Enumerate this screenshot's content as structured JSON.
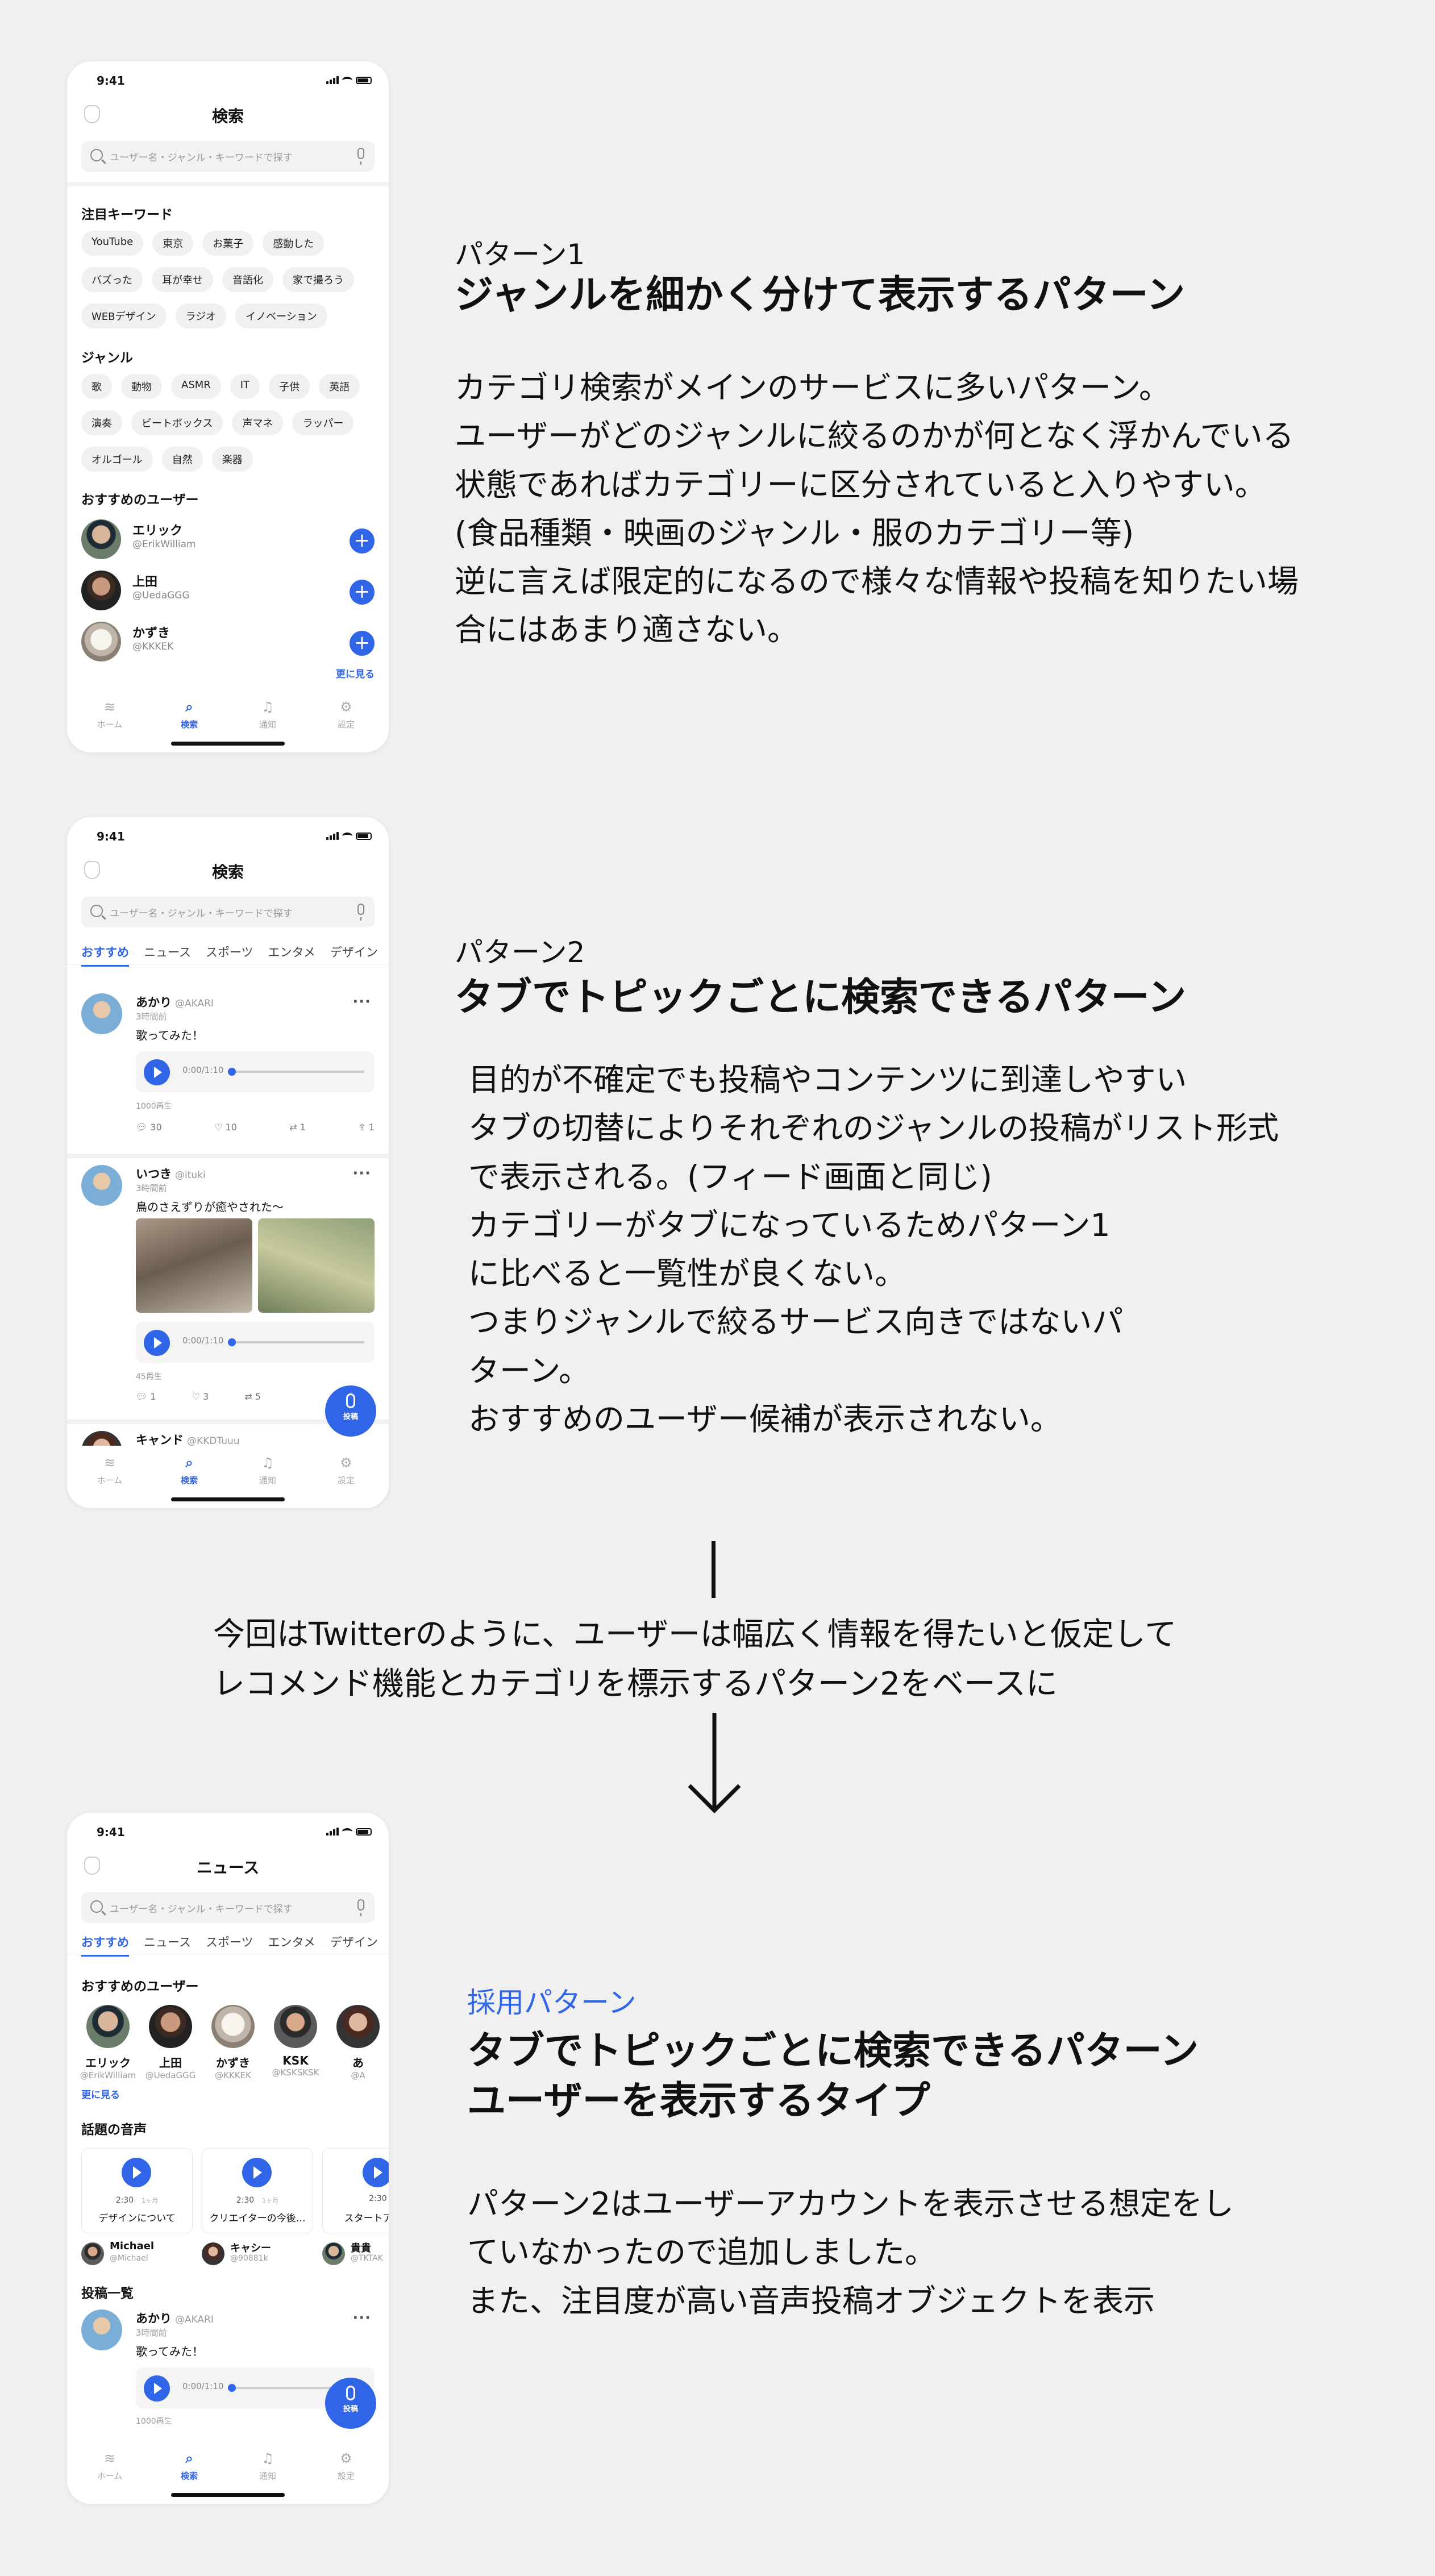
{
  "status_time": "9:41",
  "search_placeholder": "ユーザー名・ジャンル・キーワードで探す",
  "phone1": {
    "title": "検索",
    "keywords_heading": "注目キーワード",
    "keywords": [
      "YouTube",
      "東京",
      "お菓子",
      "感動した",
      "バズった",
      "耳が幸せ",
      "音語化",
      "家で撮ろう",
      "WEBデザイン",
      "ラジオ",
      "イノベーション"
    ],
    "genre_heading": "ジャンル",
    "genres": [
      "歌",
      "動物",
      "ASMR",
      "IT",
      "子供",
      "英語",
      "演奏",
      "ビートボックス",
      "声マネ",
      "ラッパー",
      "オルゴール",
      "自然",
      "楽器"
    ],
    "users_heading": "おすすめのユーザー",
    "users": [
      {
        "name": "エリック",
        "handle": "@ErikWilliam"
      },
      {
        "name": "上田",
        "handle": "@UedaGGG"
      },
      {
        "name": "かずき",
        "handle": "@KKKEK"
      }
    ],
    "more_label": "更に見る"
  },
  "tabbar": {
    "home": "ホーム",
    "search": "検索",
    "notify": "通知",
    "settings": "設定"
  },
  "tabs": [
    "おすすめ",
    "ニュース",
    "スポーツ",
    "エンタメ",
    "デザイン"
  ],
  "phone2": {
    "title": "検索",
    "post1": {
      "name": "あかり",
      "handle": "@AKARI",
      "time": "3時間前",
      "body": "歌ってみた！",
      "ptime": "0:00/1:10",
      "plays": "1000再生",
      "comments": "30",
      "likes": "10",
      "reposts": "1",
      "shares": "1"
    },
    "post2": {
      "name": "いつき",
      "handle": "@ituki",
      "time": "3時間前",
      "body": "鳥のさえずりが癒やされた〜",
      "ptime": "0:00/1:10",
      "plays": "45再生",
      "comments": "1",
      "likes": "3",
      "reposts": "5"
    },
    "post3_name": "キャンド",
    "post3_handle": "@KKDTuuu",
    "fab_label": "投稿"
  },
  "phone3": {
    "title": "ニュース",
    "rec_heading": "おすすめのユーザー",
    "rec_users": [
      {
        "name": "エリック",
        "handle": "@ErikWilliam"
      },
      {
        "name": "上田",
        "handle": "@UedaGGG"
      },
      {
        "name": "かずき",
        "handle": "@KKKEK"
      },
      {
        "name": "KSK",
        "handle": "@KSKSKSK"
      },
      {
        "name": "あ",
        "handle": "@A"
      }
    ],
    "more_label": "更に見る",
    "voice_heading": "話題の音声",
    "voices": [
      {
        "dur": "2:30",
        "ago": "1ヶ月",
        "title": "デザインについて",
        "user": "Michael",
        "handle": "@Michael"
      },
      {
        "dur": "2:30",
        "ago": "1ヶ月",
        "title": "クリエイターの今後…",
        "user": "キャシー",
        "handle": "@90881k"
      },
      {
        "dur": "2:30",
        "ago": "",
        "title": "スタートアップ",
        "user": "貴貴",
        "handle": "@TKTAK"
      }
    ],
    "list_heading": "投稿一覧",
    "post": {
      "name": "あかり",
      "handle": "@AKARI",
      "time": "3時間前",
      "body": "歌ってみた！",
      "ptime": "0:00/1:10",
      "plays": "1000再生"
    },
    "fab_label": "投稿"
  },
  "pattern1": {
    "label": "パターン1",
    "title": "ジャンルを細かく分けて表示するパターン",
    "desc": "カテゴリ検索がメインのサービスに多いパターン。\nユーザーがどのジャンルに絞るのかが何となく浮かんでいる\n状態であればカテゴリーに区分されていると入りやすい。\n(食品種類・映画のジャンル・服のカテゴリー等)\n逆に言えば限定的になるので様々な情報や投稿を知りたい場\n合にはあまり適さない。"
  },
  "pattern2": {
    "label": "パターン2",
    "title": "タブでトピックごとに検索できるパターン",
    "desc": "目的が不確定でも投稿やコンテンツに到達しやすい\nタブの切替によりそれぞれのジャンルの投稿がリスト形式\nで表示される。(フィード画面と同じ)\nカテゴリーがタブになっているためパターン1\nに比べると一覧性が良くない。\nつまりジャンルで絞るサービス向きではないパ\nターン。\nおすすめのユーザー候補が表示されない。"
  },
  "decision": {
    "line1": "今回はTwitterのように、ユーザーは幅広く情報を得たいと仮定して",
    "line2": "レコメンド機能とカテゴリを標示するパターン2をベースに"
  },
  "adopted": {
    "label": "採用パターン",
    "title1": "タブでトピックごとに検索できるパターン",
    "title2": "ユーザーを表示するタイプ",
    "desc": "パターン2はユーザーアカウントを表示させる想定をし\nていなかったので追加しました。\nまた、注目度が高い音声投稿オブジェクトを表示"
  },
  "colors": {
    "accent": "#3065e8",
    "background": "#f0f0f0"
  }
}
